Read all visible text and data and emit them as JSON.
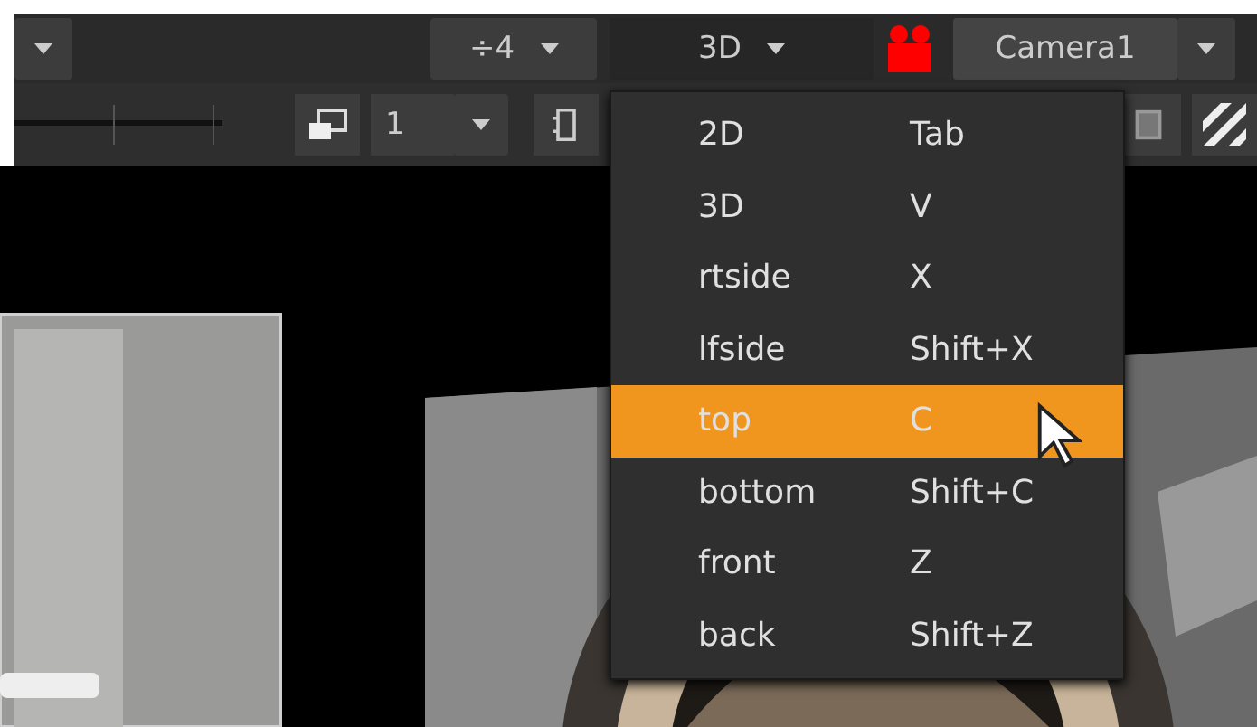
{
  "toolbar": {
    "downscale": "÷4",
    "view_mode": "3D",
    "camera": "Camera1"
  },
  "toolbar_2": {
    "frame_field": "1"
  },
  "view_menu": {
    "items": [
      {
        "label": "2D",
        "shortcut": "Tab",
        "selected": false
      },
      {
        "label": "3D",
        "shortcut": "V",
        "selected": false
      },
      {
        "label": "rtside",
        "shortcut": "X",
        "selected": false
      },
      {
        "label": "lfside",
        "shortcut": "Shift+X",
        "selected": false
      },
      {
        "label": "top",
        "shortcut": "C",
        "selected": true
      },
      {
        "label": "bottom",
        "shortcut": "Shift+C",
        "selected": false
      },
      {
        "label": "front",
        "shortcut": "Z",
        "selected": false
      },
      {
        "label": "back",
        "shortcut": "Shift+Z",
        "selected": false
      }
    ]
  }
}
